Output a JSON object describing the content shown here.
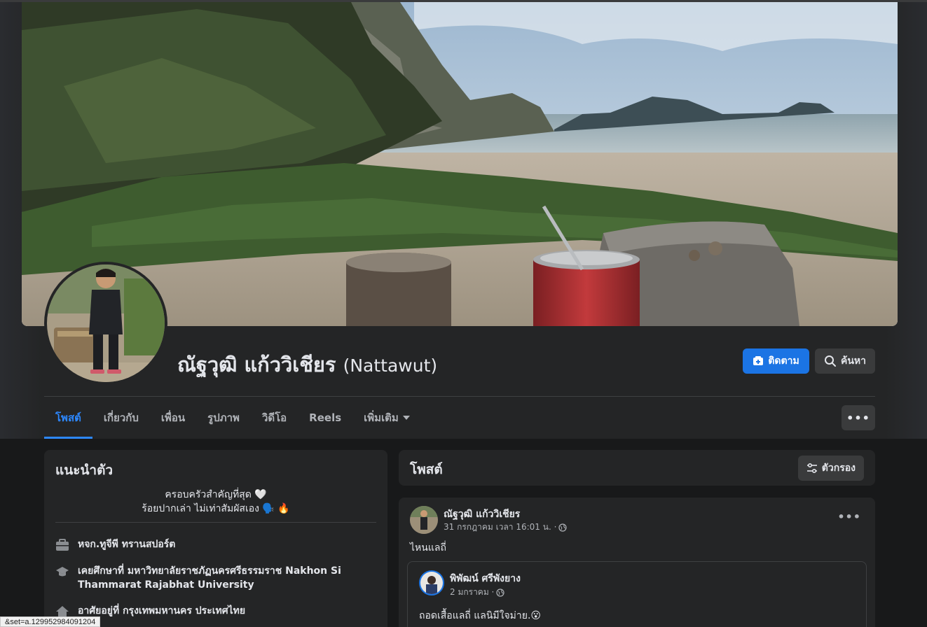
{
  "profile": {
    "name": "ณัฐวุฒิ แก้ววิเชียร",
    "alt_name": "(Nattawut)",
    "follow_label": "ติดตาม",
    "search_label": "ค้นหา"
  },
  "tabs": [
    {
      "label": "โพสต์",
      "active": true
    },
    {
      "label": "เกี่ยวกับ",
      "active": false
    },
    {
      "label": "เพื่อน",
      "active": false
    },
    {
      "label": "รูปภาพ",
      "active": false
    },
    {
      "label": "วิดีโอ",
      "active": false
    },
    {
      "label": "Reels",
      "active": false
    },
    {
      "label": "เพิ่มเติม",
      "active": false
    }
  ],
  "intro": {
    "title": "แนะนำตัว",
    "bio_line1": "ครอบครัวสำคัญที่สุด 🤍",
    "bio_line2": "ร้อยปากเล่า ไม่เท่าสัมผัสเอง 🗣️ 🔥",
    "work": "หจก.ทูจีพี ทรานสปอร์ต",
    "education": "เคยศึกษาที่ มหาวิทยาลัยราชภัฏนครศรีธรรมราช Nakhon Si Thammarat Rajabhat University",
    "lives": "อาศัยอยู่ที่ กรุงเทพมหานคร ประเทศไทย"
  },
  "posts_header": {
    "title": "โพสต์",
    "filter_label": "ตัวกรอง"
  },
  "post": {
    "author": "ณัฐวุฒิ แก้ววิเชียร",
    "time": "31 กรกฎาคม เวลา 16:01 น. ·",
    "text": "ไหนแลถี่",
    "shared": {
      "author": "พิพัฒน์ ศรีพังยาง",
      "time": "2 มกราคม ·",
      "text": "ถอดเสื้อแลถี่ แลนิมีใจม่าย.😮"
    }
  },
  "status_bar": {
    "url": "&set=a.129952984091204"
  },
  "colors": {
    "accent": "#2d88ff",
    "follow_button": "#1b74e4",
    "card": "#242526",
    "background": "#18191a"
  }
}
